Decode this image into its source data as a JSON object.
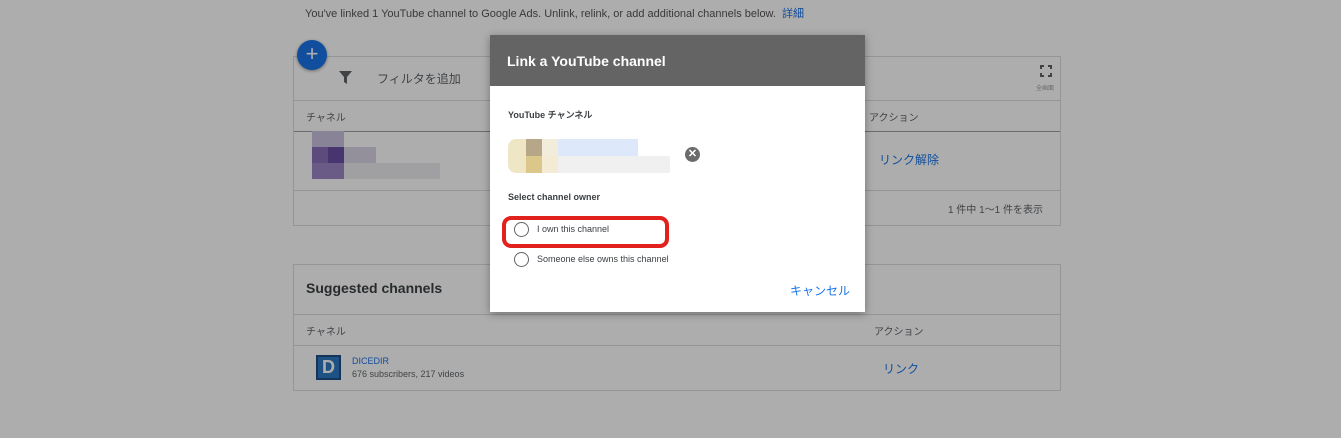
{
  "background": {
    "info_text": "You've linked 1 YouTube channel to Google Ads. Unlink, relink, or add additional channels below.",
    "info_link": "詳細",
    "add_button": "+",
    "filter_label": "フィルタを追加",
    "fullscreen_caption": "全画面",
    "linked_table": {
      "col_channel": "チャネル",
      "col_action": "アクション",
      "unlink": "リンク解除",
      "pager": "1 件中 1〜1 件を表示"
    },
    "suggested": {
      "title": "Suggested channels",
      "col_channel": "チャネル",
      "col_action": "アクション",
      "rows": [
        {
          "logo": "D",
          "name": "DICEDIR",
          "meta": "676 subscribers, 217 videos",
          "action": "リンク"
        }
      ]
    }
  },
  "dialog": {
    "title": "Link a YouTube channel",
    "channel_label": "YouTube チャンネル",
    "owner_label": "Select channel owner",
    "options": [
      {
        "label": "I own this channel",
        "selected": false
      },
      {
        "label": "Someone else owns this channel",
        "selected": false
      }
    ],
    "cancel": "キャンセル"
  },
  "colors": {
    "accent": "#1a73e8",
    "dialog_header": "#646464",
    "highlight": "#e2211c"
  }
}
